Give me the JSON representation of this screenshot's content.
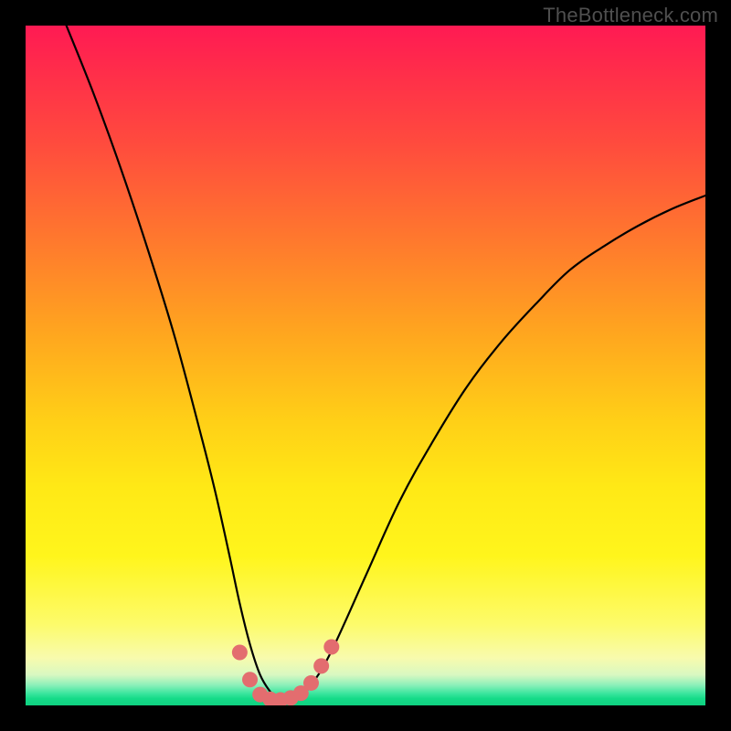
{
  "watermark": "TheBottleneck.com",
  "colors": {
    "frame": "#000000",
    "gradient_top": "#ff1a53",
    "gradient_bottom": "#0fd181",
    "curve": "#000000",
    "marker_fill": "#e36d6f",
    "marker_stroke": "#d85b5e"
  },
  "chart_data": {
    "type": "line",
    "title": "",
    "xlabel": "",
    "ylabel": "",
    "xlim": [
      0,
      100
    ],
    "ylim": [
      0,
      100
    ],
    "grid": false,
    "legend": false,
    "series": [
      {
        "name": "bottleneck-curve",
        "x": [
          6,
          10,
          14,
          18,
          22,
          26,
          28,
          30,
          31.5,
          33,
          34.5,
          36,
          37,
          38,
          39,
          40,
          42,
          45,
          50,
          55,
          60,
          65,
          70,
          75,
          80,
          85,
          90,
          95,
          100
        ],
        "y": [
          100,
          90,
          79,
          67,
          54,
          39,
          31,
          22,
          15,
          9,
          4.5,
          2,
          1,
          0.7,
          0.8,
          1.2,
          3,
          8,
          19,
          30,
          39,
          47,
          53.5,
          59,
          64,
          67.5,
          70.5,
          73,
          75
        ]
      }
    ],
    "markers": [
      {
        "x": 31.5,
        "y": 7.8
      },
      {
        "x": 33.0,
        "y": 3.8
      },
      {
        "x": 34.5,
        "y": 1.6
      },
      {
        "x": 36.0,
        "y": 0.9
      },
      {
        "x": 37.5,
        "y": 0.8
      },
      {
        "x": 39.0,
        "y": 1.1
      },
      {
        "x": 40.5,
        "y": 1.8
      },
      {
        "x": 42.0,
        "y": 3.3
      },
      {
        "x": 43.5,
        "y": 5.8
      },
      {
        "x": 45.0,
        "y": 8.6
      }
    ]
  }
}
